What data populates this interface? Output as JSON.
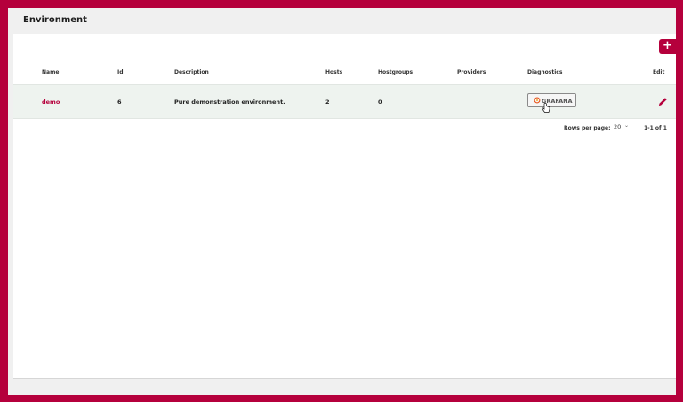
{
  "page": {
    "title": "Environment"
  },
  "toolbar": {
    "add_label": "+"
  },
  "table": {
    "columns": [
      "Name",
      "Id",
      "Description",
      "Hosts",
      "Hostgroups",
      "Providers",
      "Diagnostics",
      "Edit"
    ],
    "rows": [
      {
        "name": "demo",
        "id": "6",
        "description": "Pure demonstration environment.",
        "hosts": "2",
        "hostgroups": "0",
        "providers": "",
        "diagnostics_label": "GRAFANA"
      }
    ]
  },
  "pagination": {
    "rows_per_page_label": "Rows per page:",
    "rows_per_page_value": "20",
    "range": "1-1 of 1"
  },
  "colors": {
    "accent": "#b5003c",
    "row_bg": "#eef3ef",
    "background": "#f0f0f0"
  }
}
